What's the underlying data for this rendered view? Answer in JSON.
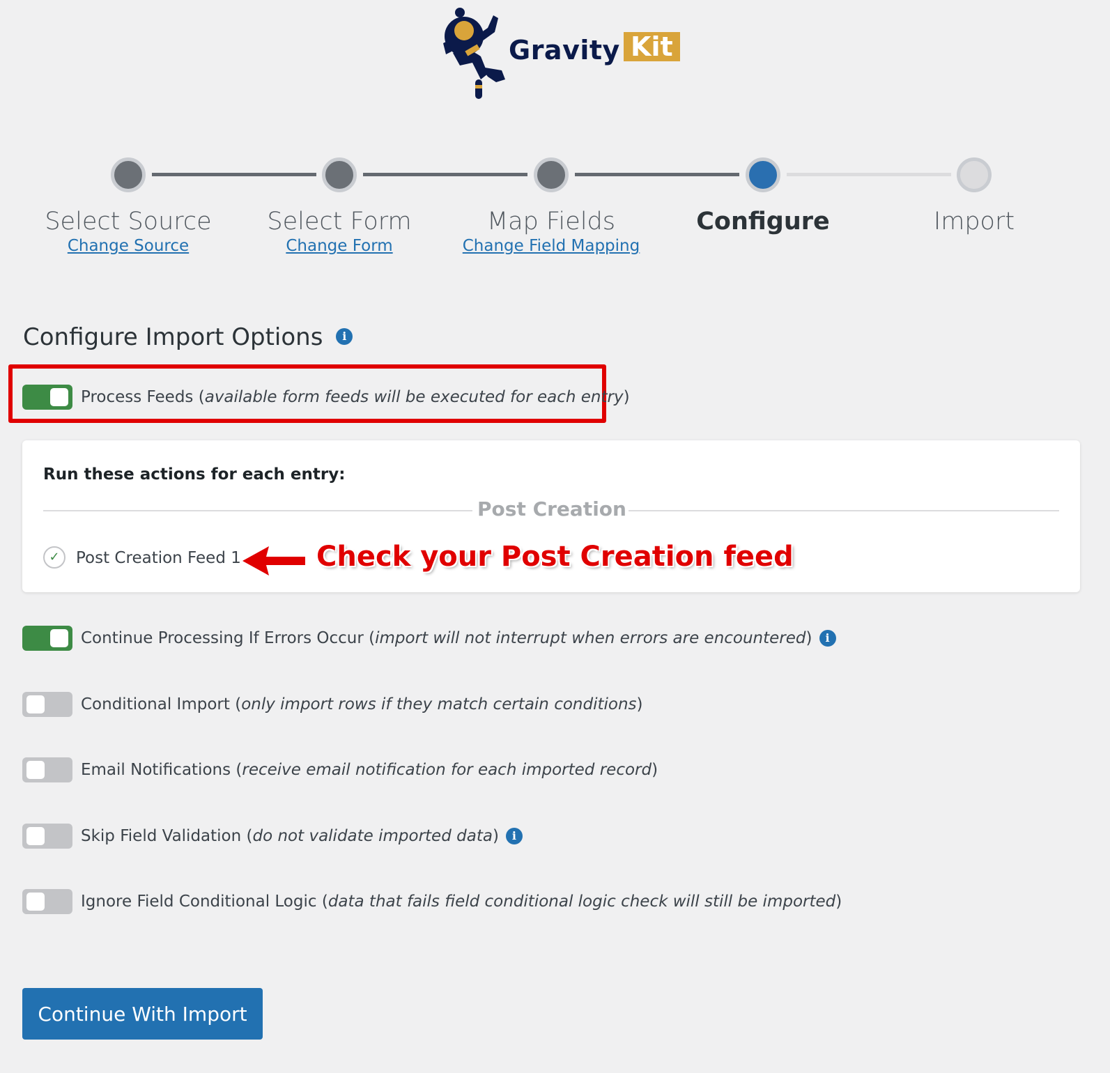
{
  "brand": {
    "name": "Gravity",
    "accent": "Kit",
    "accent_color": "#d9a43a",
    "name_color": "#0b1a4a"
  },
  "steps": [
    {
      "label": "Select Source",
      "link": "Change Source",
      "state": "done"
    },
    {
      "label": "Select Form",
      "link": "Change Form",
      "state": "done"
    },
    {
      "label": "Map Fields",
      "link": "Change Field Mapping",
      "state": "done"
    },
    {
      "label": "Configure",
      "link": "",
      "state": "current"
    },
    {
      "label": "Import",
      "link": "",
      "state": "todo"
    }
  ],
  "page_title": "Configure Import Options",
  "info_icon_glyph": "i",
  "options": {
    "process_feeds": {
      "label": "Process Feeds",
      "hint": "available form feeds will be executed for each entry",
      "enabled": true
    },
    "continue_on_errors": {
      "label": "Continue Processing If Errors Occur",
      "hint": "import will not interrupt when errors are encountered",
      "enabled": true
    },
    "conditional_import": {
      "label": "Conditional Import",
      "hint": "only import rows if they match certain conditions",
      "enabled": false
    },
    "email_notifications": {
      "label": "Email Notifications",
      "hint": "receive email notification for each imported record",
      "enabled": false
    },
    "skip_validation": {
      "label": "Skip Field Validation",
      "hint": "do not validate imported data",
      "enabled": false
    },
    "ignore_conditional_logic": {
      "label": "Ignore Field Conditional Logic",
      "hint": "data that fails field conditional logic check will still be imported",
      "enabled": false
    }
  },
  "feeds_card": {
    "title": "Run these actions for each entry:",
    "group": "Post Creation",
    "feeds": [
      {
        "label": "Post Creation Feed 1",
        "checked": true
      }
    ]
  },
  "annotation": "Check your Post Creation feed",
  "submit_label": "Continue With Import",
  "colors": {
    "toggle_on": "#3d8b45",
    "toggle_off": "#c3c4c7",
    "primary": "#2271b1",
    "highlight": "#e00000"
  }
}
